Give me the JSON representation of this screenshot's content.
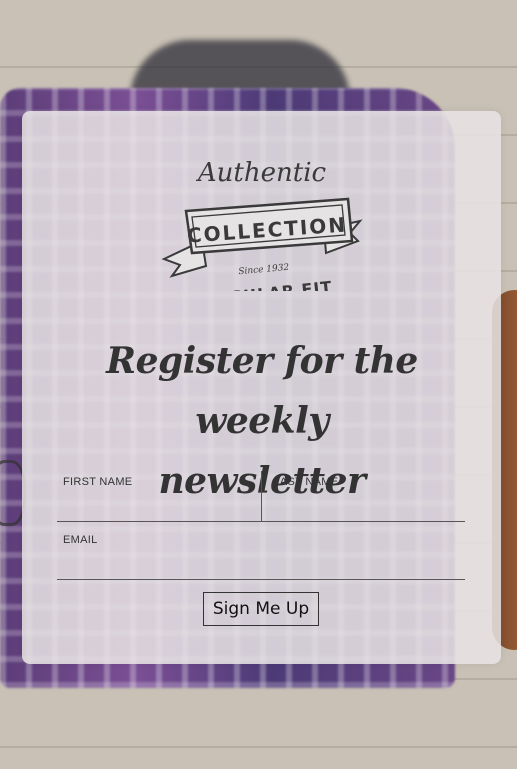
{
  "logo": {
    "script_text": "Authentic",
    "banner_text": "COLLECTION",
    "since_text": "Since 1932",
    "bottom_text": "REGULAR FIT"
  },
  "headline": {
    "line1": "Register for the weekly",
    "line2": "newsletter"
  },
  "form": {
    "first_name_label": "FIRST NAME",
    "last_name_label": "LAST NAME",
    "email_label": "EMAIL",
    "first_name_value": "",
    "last_name_value": "",
    "email_value": "",
    "submit_label": "Sign Me Up"
  }
}
